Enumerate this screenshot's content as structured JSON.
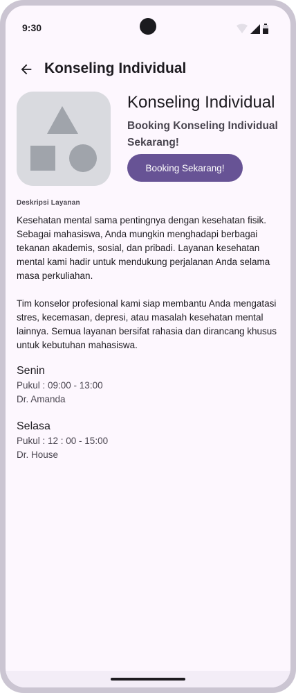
{
  "status_bar": {
    "time": "9:30",
    "icons": [
      "wifi-icon",
      "cellular-signal-icon",
      "battery-icon"
    ]
  },
  "app_bar": {
    "back_icon": "arrow-left-icon",
    "title": "Konseling Individual"
  },
  "hero": {
    "image_icon": "shapes-placeholder-icon",
    "title": "Konseling Individual",
    "subtitle": "Booking Konseling Individual Sekarang!",
    "button_label": "Booking Sekarang!"
  },
  "description": {
    "label": "Deskripsi Layanan",
    "paragraphs": [
      "Kesehatan mental sama pentingnya dengan kesehatan fisik. Sebagai mahasiswa, Anda mungkin menghadapi berbagai tekanan akademis, sosial, dan pribadi. Layanan kesehatan mental kami hadir untuk mendukung perjalanan Anda selama masa perkuliahan.",
      "Tim konselor profesional kami siap membantu Anda mengatasi stres, kecemasan, depresi, atau masalah kesehatan mental lainnya. Semua layanan bersifat rahasia dan dirancang khusus untuk kebutuhan mahasiswa."
    ]
  },
  "schedules": [
    {
      "day": "Senin",
      "time": "Pukul : 09:00 - 13:00",
      "doctor": "Dr. Amanda"
    },
    {
      "day": "Selasa",
      "time": "Pukul : 12 : 00 - 15:00",
      "doctor": "Dr. House"
    }
  ],
  "colors": {
    "background": "#fdf7fe",
    "primary": "#675395",
    "on_primary": "#ffffff",
    "text": "#1d1b20",
    "secondary_text": "#49454f",
    "placeholder_bg": "#d9dadf",
    "placeholder_shape": "#a0a4ab",
    "frame": "#cbc5d2"
  }
}
